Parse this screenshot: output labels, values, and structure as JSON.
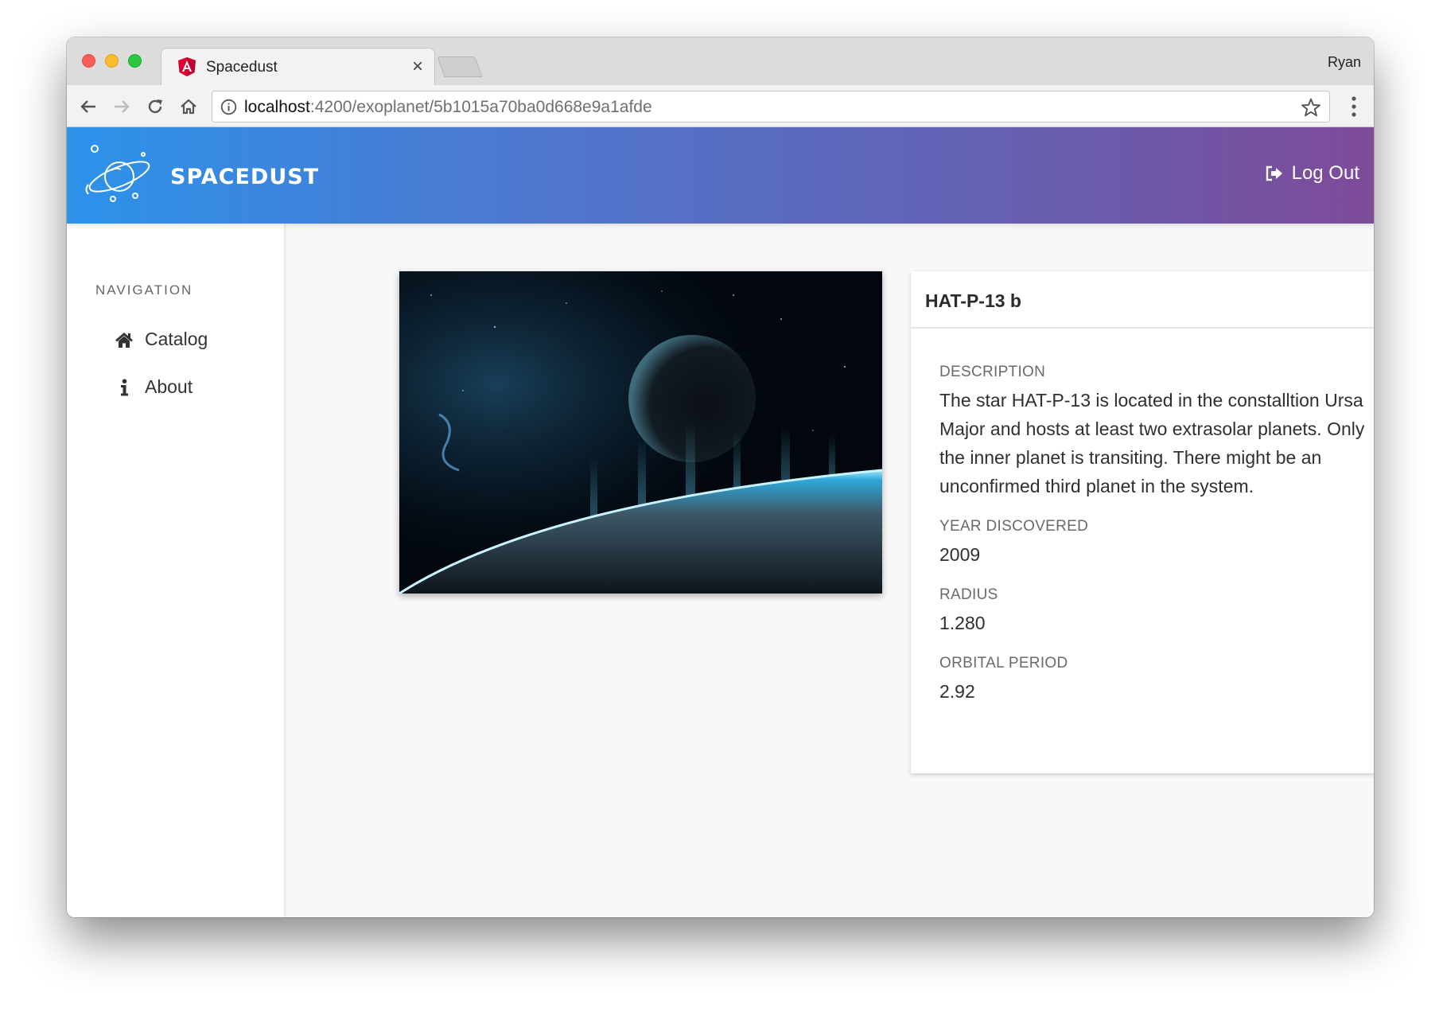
{
  "browser": {
    "tab_title": "Spacedust",
    "tab_close": "×",
    "profile_name": "Ryan",
    "url_host": "localhost",
    "url_path": ":4200/exoplanet/5b1015a70ba0d668e9a1afde",
    "icons": {
      "back": "back-arrow-icon",
      "forward": "forward-arrow-icon",
      "reload": "reload-icon",
      "home": "home-icon",
      "info": "info-icon",
      "star": "bookmark-star-icon",
      "menu": "vertical-dots-menu-icon"
    }
  },
  "header": {
    "brand": "SpaceDust",
    "logout_label": "Log Out",
    "gradient_start": "#2c92ea",
    "gradient_end": "#7d4b99"
  },
  "sidebar": {
    "heading": "NAVIGATION",
    "items": [
      {
        "label": "Catalog",
        "icon": "home-icon"
      },
      {
        "label": "About",
        "icon": "info-icon"
      }
    ]
  },
  "planet": {
    "name": "HAT-P-13 b",
    "fields": [
      {
        "label": "Description",
        "value": "The star HAT-P-13 is located in the constalltion Ursa Major and hosts at least two extrasolar planets. Only the inner planet is transiting. There might be an unconfirmed third planet in the system."
      },
      {
        "label": "Year Discovered",
        "value": "2009"
      },
      {
        "label": "Radius",
        "value": "1.280"
      },
      {
        "label": "Orbital Period",
        "value": "2.92"
      }
    ]
  }
}
